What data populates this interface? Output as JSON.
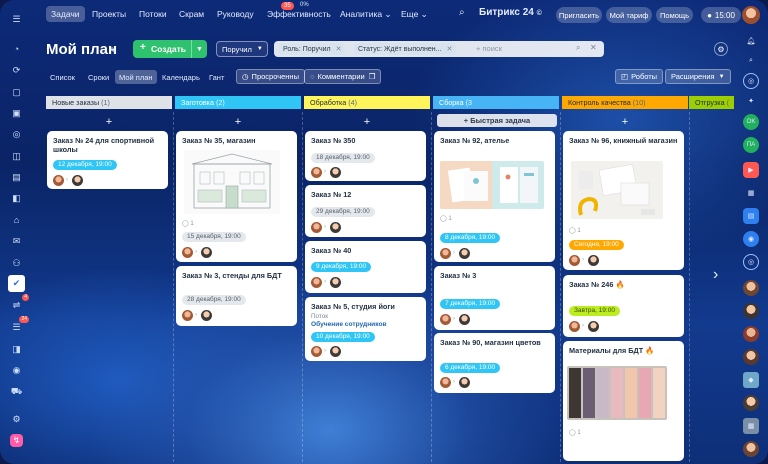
{
  "topbar": {
    "nav": [
      "Задачи",
      "Проекты",
      "Потоки",
      "Скрам",
      "Руководу",
      "Эффективность",
      "Аналитика ⌄",
      "Еще ⌄"
    ],
    "nav_badge": "35",
    "nav_small": "0%",
    "brand": "Битрикс 24",
    "brand_mark": "©",
    "invite": "Пригласить",
    "tariff": "Мой тариф",
    "help": "Помощь",
    "clock": "15:00"
  },
  "toolbar": {
    "title": "Мой план",
    "create": "Создать",
    "role": "Поручил",
    "chip1": "Роль: Поручил",
    "chip2": "Статус: Ждёт выполнен...",
    "search_placeholder": "+ поиск"
  },
  "viewtabs": {
    "tabs": [
      "Список",
      "Сроки",
      "Мой план",
      "Календарь",
      "Гант"
    ],
    "overdue": "Просроченны",
    "comments": "Комментарии",
    "robots": "Роботы",
    "extensions": "Расширения"
  },
  "left_badges": {
    "feed": "4",
    "tasks": "24"
  },
  "columns": [
    {
      "name": "Новые заказы",
      "count": "(1)",
      "color": "#dfe3e8"
    },
    {
      "name": "Заготовка",
      "count": "(2)",
      "color": "#2fc6f6"
    },
    {
      "name": "Обработка",
      "count": "(4)",
      "color": "#fff55a"
    },
    {
      "name": "Сборка",
      "count": "(3",
      "color": "#47b4f5"
    },
    {
      "name": "Контроль качества",
      "count": "(10)",
      "color": "#ffa900"
    },
    {
      "name": "Отгрузка",
      "count": "(",
      "color": "#9dcf00"
    }
  ],
  "quick_task": "+ Быстрая задача",
  "cards": {
    "c1": {
      "title": "Заказ № 24 для спортивной школы",
      "date": "12 декабря, 19:00"
    },
    "c2": {
      "title": "Заказ № 35, магазин",
      "count": "1",
      "date": "15 декабря, 19:00"
    },
    "c3": {
      "title": "Заказ № 3, стенды для БДТ",
      "date": "28 декабря, 19:00"
    },
    "c4": {
      "title": "Заказ № 350",
      "date": "18 декабря, 19:00"
    },
    "c5": {
      "title": "Заказ № 12",
      "date": "29 декабря, 19:00"
    },
    "c6": {
      "title": "Заказ № 40",
      "date": "9 декабря, 19:00"
    },
    "c7": {
      "title": "Заказ № 5, студия йоги",
      "label": "Поток",
      "link": "Обучение сотрудников",
      "date": "10 декабря, 19:00"
    },
    "c8": {
      "title": "Заказ № 92, ателье",
      "count": "1",
      "date": "8 декабря, 19:00"
    },
    "c9": {
      "title": "Заказ № 3",
      "date": "7 декабря, 19:00"
    },
    "c10": {
      "title": "Заказ № 90, магазин цветов",
      "date": "6 декабря, 19:00"
    },
    "c11": {
      "title": "Заказ № 96, книжный магазин",
      "count": "1",
      "date": "Сегодня, 19:00"
    },
    "c12": {
      "title": "Заказ № 246 🔥",
      "date": "Завтра, 19:00"
    },
    "c13": {
      "title": "Материалы для БДТ 🔥",
      "count": "1"
    }
  },
  "colors": {
    "accent_green": "#2fc26e",
    "overdue_orange": "#ffa900",
    "today_green": "#bbed21",
    "date_blue": "#2fc6f6"
  }
}
